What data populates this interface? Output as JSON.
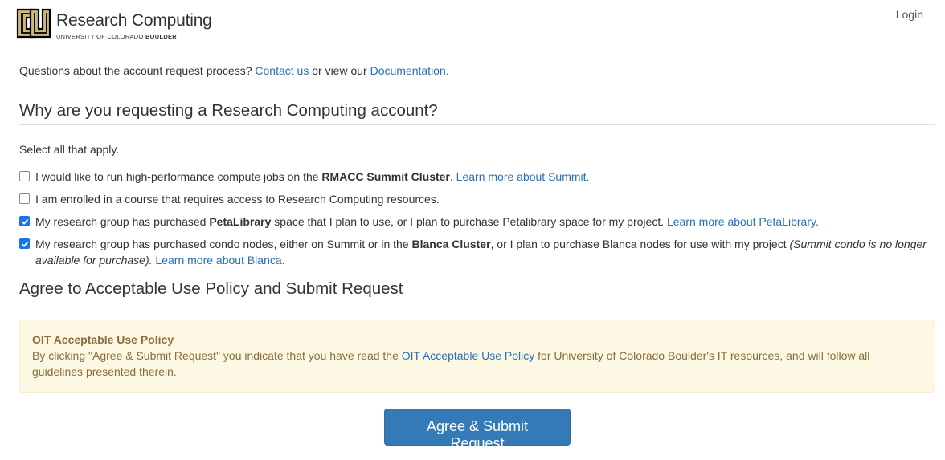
{
  "header": {
    "logo_title": "Research Computing",
    "logo_sub_plain": "UNIVERSITY OF COLORADO",
    "logo_sub_bold": "BOULDER",
    "login_label": "Login"
  },
  "questions": {
    "prefix": "Questions about the account request process?",
    "contact_link": "Contact us",
    "middle": "or view our",
    "doc_link": "Documentation."
  },
  "why_section": {
    "heading": "Why are you requesting a Research Computing account?",
    "hint": "Select all that apply.",
    "options": [
      {
        "checked": false,
        "text_before": "I would like to run high-performance compute jobs on the",
        "bold": "RMACC Summit Cluster",
        "text_after": ".",
        "link": "Learn more about Summit."
      },
      {
        "checked": false,
        "text": "I am enrolled in a course that requires access to Research Computing resources."
      },
      {
        "checked": true,
        "text_before": "My research group has purchased",
        "bold": "PetaLibrary",
        "text_after": "space that I plan to use, or I plan to purchase Petalibrary space for my project.",
        "link": "Learn more about PetaLibrary."
      },
      {
        "checked": true,
        "text_before": "My research group has purchased condo nodes, either on Summit or in the",
        "bold": "Blanca Cluster",
        "text_after": ", or I plan to purchase Blanca nodes for use with my project",
        "italic": "(Summit condo is no longer available for purchase).",
        "link": "Learn more about Blanca."
      }
    ]
  },
  "agree_section": {
    "heading": "Agree to Acceptable Use Policy and Submit Request",
    "alert_title": "OIT Acceptable Use Policy",
    "alert_text_before": "By clicking \"Agree & Submit Request\" you indicate that you have read the",
    "alert_link": "OIT Acceptable Use Policy",
    "alert_text_after": "for University of Colorado Boulder's IT resources, and will follow all guidelines presented therein.",
    "submit_label": "Agree & Submit Request"
  },
  "colors": {
    "link": "#2a6fb5",
    "checkbox_checked": "#1a73e8",
    "alert_bg": "#fcf8e3",
    "alert_text": "#8a6d3b",
    "button": "#337ab7",
    "cu_gold": "#cfb87c"
  }
}
